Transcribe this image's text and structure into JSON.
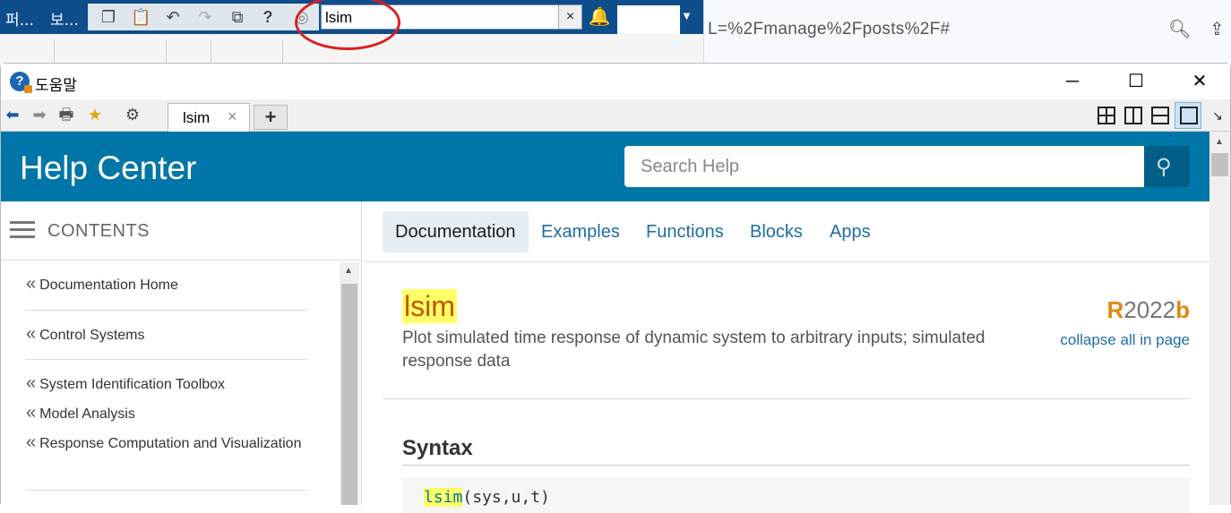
{
  "matlab": {
    "tabs": [
      "퍼...",
      "보..."
    ],
    "search_value": "lsim",
    "search_clear": "×",
    "icons": [
      "copy-icon",
      "paste-icon",
      "undo-icon",
      "redo-icon",
      "window-icon",
      "help-icon",
      "community-icon",
      "bell-icon"
    ]
  },
  "browser": {
    "url_fragment": "L=%2Fmanage%2Fposts%2F#"
  },
  "help_window": {
    "title": "도움말",
    "tab_label": "lsim",
    "tab_close": "×",
    "add_tab": "+"
  },
  "help_center": {
    "title": "Help Center",
    "search_placeholder": "Search Help"
  },
  "sidebar": {
    "contents_label": "CONTENTS",
    "links": [
      "Documentation Home",
      "Control Systems",
      "System Identification Toolbox",
      "Model Analysis",
      "Response Computation and Visualization"
    ]
  },
  "main": {
    "nav_tabs": [
      "Documentation",
      "Examples",
      "Functions",
      "Blocks",
      "Apps"
    ],
    "page_title": "lsim",
    "description": "Plot simulated time response of dynamic system to arbitrary inputs; simulated response data",
    "release_prefix": "R",
    "release_year": "2022",
    "release_suffix": "b",
    "collapse_link": "collapse all in page",
    "syntax_heading": "Syntax",
    "code_fn": "lsim",
    "code_args": "(sys,u,t)"
  },
  "colors": {
    "header_blue": "#0076a8",
    "title_orange": "#c45400",
    "highlight_yellow": "#ffff66",
    "release_orange": "#e08910",
    "matlab_blue": "#0e4d8c",
    "annotation_red": "#d9201f"
  }
}
